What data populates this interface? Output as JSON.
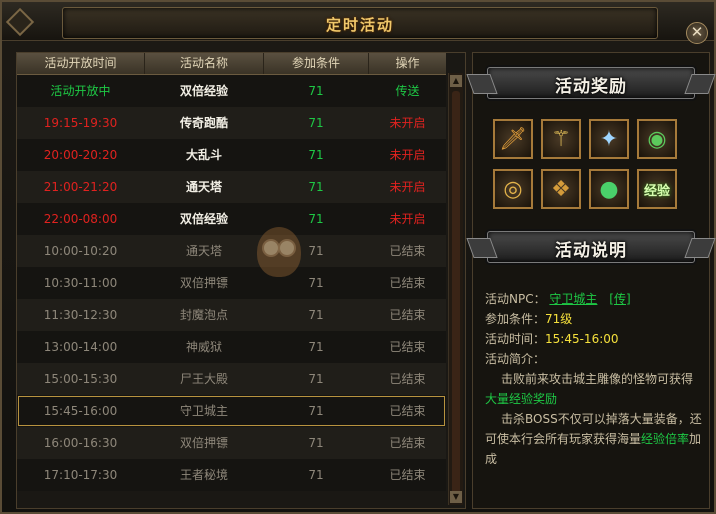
{
  "window": {
    "title": "定时活动",
    "close_glyph": "✕"
  },
  "table": {
    "headers": [
      "活动开放时间",
      "活动名称",
      "参加条件",
      "操作"
    ],
    "rows": [
      {
        "time": "活动开放中",
        "name": "双倍经验",
        "level": "71",
        "action": "传送",
        "time_color": "#1ec845",
        "name_color": "#f2efe5",
        "level_color": "#1ec845",
        "action_color": "#1ec845",
        "name_bold": true
      },
      {
        "time": "19:15-19:30",
        "name": "传奇跑酷",
        "level": "71",
        "action": "未开启",
        "time_color": "#e0221f",
        "name_color": "#f2efe5",
        "level_color": "#1ec845",
        "action_color": "#e0221f",
        "name_bold": true
      },
      {
        "time": "20:00-20:20",
        "name": "大乱斗",
        "level": "71",
        "action": "未开启",
        "time_color": "#e0221f",
        "name_color": "#f2efe5",
        "level_color": "#1ec845",
        "action_color": "#e0221f",
        "name_bold": true
      },
      {
        "time": "21:00-21:20",
        "name": "通天塔",
        "level": "71",
        "action": "未开启",
        "time_color": "#e0221f",
        "name_color": "#f2efe5",
        "level_color": "#1ec845",
        "action_color": "#e0221f",
        "name_bold": true
      },
      {
        "time": "22:00-08:00",
        "name": "双倍经验",
        "level": "71",
        "action": "未开启",
        "time_color": "#e0221f",
        "name_color": "#f2efe5",
        "level_color": "#1ec845",
        "action_color": "#e0221f",
        "name_bold": true
      },
      {
        "time": "10:00-10:20",
        "name": "通天塔",
        "level": "71",
        "action": "已结束",
        "time_color": "#8e877a",
        "name_color": "#8e877a",
        "level_color": "#8e877a",
        "action_color": "#8e877a",
        "name_bold": false
      },
      {
        "time": "10:30-11:00",
        "name": "双倍押镖",
        "level": "71",
        "action": "已结束",
        "time_color": "#8e877a",
        "name_color": "#8e877a",
        "level_color": "#8e877a",
        "action_color": "#8e877a",
        "name_bold": false
      },
      {
        "time": "11:30-12:30",
        "name": "封魔泡点",
        "level": "71",
        "action": "已结束",
        "time_color": "#8e877a",
        "name_color": "#8e877a",
        "level_color": "#8e877a",
        "action_color": "#8e877a",
        "name_bold": false
      },
      {
        "time": "13:00-14:00",
        "name": "神威狱",
        "level": "71",
        "action": "已结束",
        "time_color": "#8e877a",
        "name_color": "#8e877a",
        "level_color": "#8e877a",
        "action_color": "#8e877a",
        "name_bold": false
      },
      {
        "time": "15:00-15:30",
        "name": "尸王大殿",
        "level": "71",
        "action": "已结束",
        "time_color": "#8e877a",
        "name_color": "#8e877a",
        "level_color": "#8e877a",
        "action_color": "#8e877a",
        "name_bold": false
      },
      {
        "time": "15:45-16:00",
        "name": "守卫城主",
        "level": "71",
        "action": "已结束",
        "time_color": "#8e877a",
        "name_color": "#8e877a",
        "level_color": "#8e877a",
        "action_color": "#8e877a",
        "name_bold": false,
        "selected": true
      },
      {
        "time": "16:00-16:30",
        "name": "双倍押镖",
        "level": "71",
        "action": "已结束",
        "time_color": "#8e877a",
        "name_color": "#8e877a",
        "level_color": "#8e877a",
        "action_color": "#8e877a",
        "name_bold": false
      },
      {
        "time": "17:10-17:30",
        "name": "王者秘境",
        "level": "71",
        "action": "已结束",
        "time_color": "#8e877a",
        "name_color": "#8e877a",
        "level_color": "#8e877a",
        "action_color": "#8e877a",
        "name_bold": false
      }
    ]
  },
  "rewards": {
    "title": "活动奖励",
    "items": [
      {
        "icon": "sword-icon",
        "glyph": "🗡"
      },
      {
        "icon": "staff-icon",
        "glyph": "⚚"
      },
      {
        "icon": "fan-icon",
        "glyph": "✦"
      },
      {
        "icon": "orb-icon",
        "glyph": "◉"
      },
      {
        "icon": "ring-icon",
        "glyph": "◎"
      },
      {
        "icon": "gem-icon",
        "glyph": "❖"
      },
      {
        "icon": "green-orb-icon",
        "glyph": "●"
      },
      {
        "icon": "exp-icon",
        "glyph": "",
        "text": "经验"
      }
    ]
  },
  "description": {
    "title": "活动说明",
    "npc_label": "活动NPC：",
    "npc_name": "守卫城主",
    "npc_link": "[传]",
    "cond_label": "参加条件：",
    "cond_value": "71级",
    "time_label": "活动时间：",
    "time_value": "15:45-16:00",
    "intro_label": "活动简介：",
    "intro_1a": "击败前来攻击城主雕像的怪物可获得",
    "intro_1b": "大量经验奖励",
    "intro_2a": "击杀BOSS不仅可以掉落大量装备，还",
    "intro_2b_pre": "可使本行会所有玩家获得海量",
    "intro_2b_hl": "经验倍率",
    "intro_2b_post": "加",
    "intro_2c": "成"
  },
  "colors": {
    "gold": "#f0c76a",
    "green": "#1ec845",
    "red": "#e0221f",
    "gray": "#8e877a",
    "yellow": "#f5e03c"
  }
}
